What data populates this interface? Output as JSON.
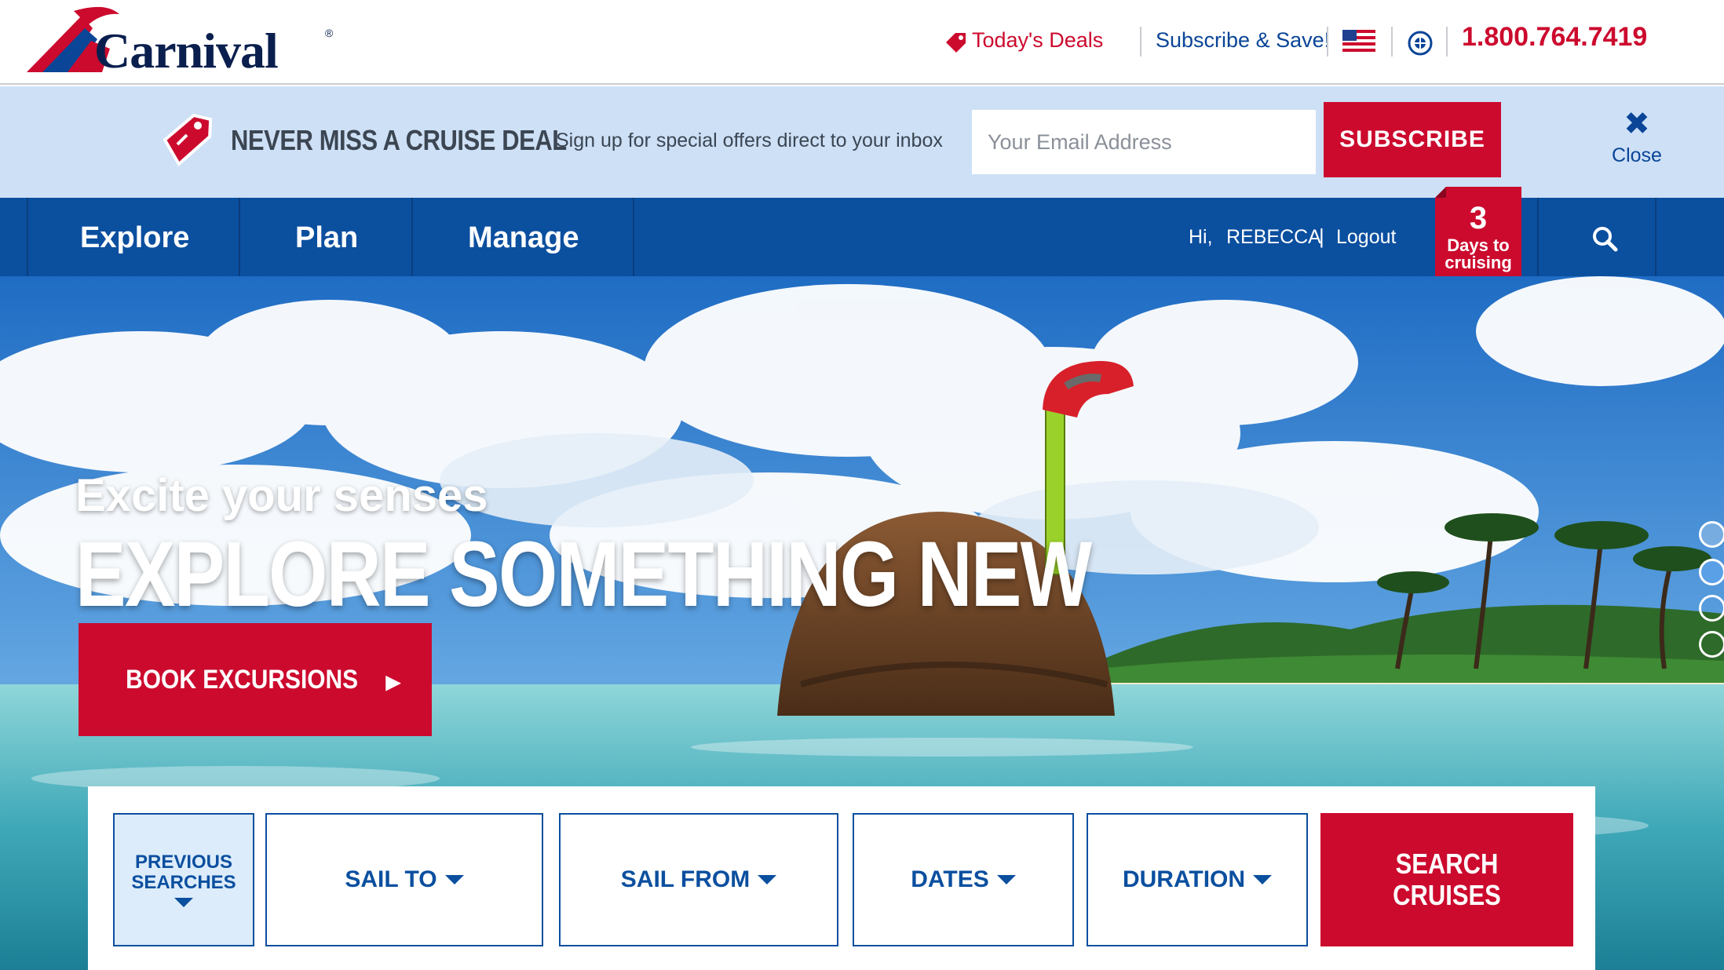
{
  "header": {
    "logo_text": "Carnival",
    "logo_mark": "®",
    "todays_deals": "Today's Deals",
    "subscribe_save": "Subscribe & Save!",
    "phone": "1.800.764.7419",
    "icons": [
      "tag-icon",
      "us-flag-icon",
      "globe-icon"
    ]
  },
  "promo": {
    "title": "NEVER MISS A CRUISE DEAL",
    "subtitle": "Sign up for special offers direct to your inbox",
    "email_placeholder": "Your Email Address",
    "subscribe_label": "SUBSCRIBE",
    "close_label": "Close",
    "close_glyph": "✖"
  },
  "nav": {
    "items": [
      {
        "label": "Explore"
      },
      {
        "label": "Plan"
      },
      {
        "label": "Manage"
      }
    ],
    "greeting": "Hi,",
    "user": "REBECCA",
    "separator": "|",
    "logout": "Logout",
    "countdown": {
      "number": "3",
      "line1": "Days to",
      "line2": "cruising"
    }
  },
  "hero": {
    "tagline": "Excite your senses",
    "headline": "EXPLORE SOMETHING NEW",
    "cta_label": "BOOK EXCURSIONS",
    "cta_arrow": "▶",
    "carousel_dots": 4,
    "active_dot": 1
  },
  "search": {
    "previous_line1": "PREVIOUS",
    "previous_line2": "SEARCHES",
    "sail_to": "SAIL TO",
    "sail_from": "SAIL FROM",
    "dates": "DATES",
    "duration": "DURATION",
    "search_line1": "SEARCH",
    "search_line2": "CRUISES"
  },
  "colors": {
    "brand_red": "#cc0a2e",
    "brand_blue": "#0b4f9f",
    "promo_bg": "#cde0f6",
    "navy": "#0a1f4e"
  }
}
